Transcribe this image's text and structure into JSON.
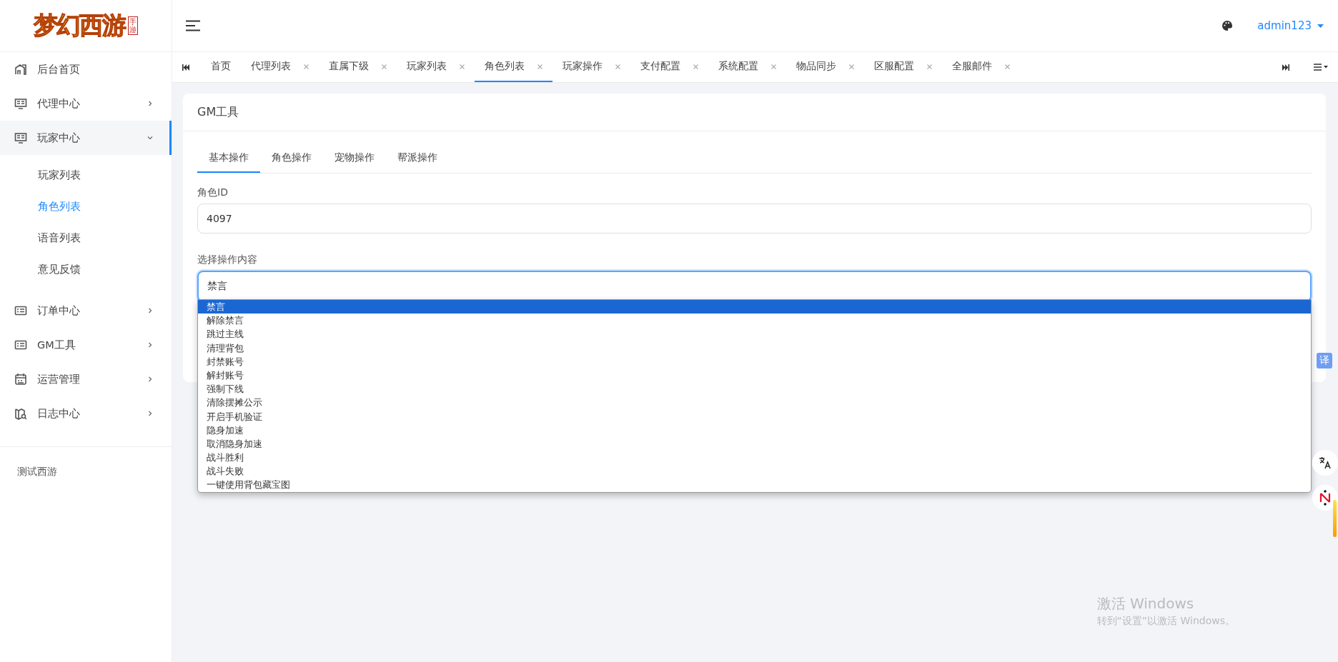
{
  "logo": {
    "title": "梦幻西游",
    "badge": "手游"
  },
  "sidebar": {
    "items": [
      {
        "label": "后台首页",
        "kind": "home",
        "selected": false
      },
      {
        "label": "代理中心",
        "kind": "monitor",
        "selected": false,
        "expanded": false
      },
      {
        "label": "玩家中心",
        "kind": "monitor",
        "selected": true,
        "expanded": true,
        "children": [
          {
            "label": "玩家列表",
            "selected": false
          },
          {
            "label": "角色列表",
            "selected": true
          },
          {
            "label": "语音列表",
            "selected": false
          },
          {
            "label": "意见反馈",
            "selected": false
          }
        ]
      },
      {
        "label": "订单中心",
        "kind": "list",
        "selected": false,
        "expanded": false
      },
      {
        "label": "GM工具",
        "kind": "list",
        "selected": false,
        "expanded": false
      },
      {
        "label": "运营管理",
        "kind": "calendar",
        "selected": false,
        "expanded": false
      },
      {
        "label": "日志中心",
        "kind": "map",
        "selected": false,
        "expanded": false
      }
    ],
    "footer": "测试西游"
  },
  "topbar": {
    "user": "admin123"
  },
  "tabs": [
    {
      "label": "首页",
      "closable": false,
      "selected": false
    },
    {
      "label": "代理列表",
      "closable": true,
      "selected": false
    },
    {
      "label": "直属下级",
      "closable": true,
      "selected": false
    },
    {
      "label": "玩家列表",
      "closable": true,
      "selected": false
    },
    {
      "label": "角色列表",
      "closable": true,
      "selected": true
    },
    {
      "label": "玩家操作",
      "closable": true,
      "selected": false
    },
    {
      "label": "支付配置",
      "closable": true,
      "selected": false
    },
    {
      "label": "系统配置",
      "closable": true,
      "selected": false
    },
    {
      "label": "物品同步",
      "closable": true,
      "selected": false
    },
    {
      "label": "区服配置",
      "closable": true,
      "selected": false
    },
    {
      "label": "全服邮件",
      "closable": true,
      "selected": false
    }
  ],
  "card": {
    "title": "GM工具",
    "tabs": [
      {
        "label": "基本操作",
        "selected": true
      },
      {
        "label": "角色操作",
        "selected": false
      },
      {
        "label": "宠物操作",
        "selected": false
      },
      {
        "label": "帮派操作",
        "selected": false
      }
    ],
    "role_id": {
      "label": "角色ID",
      "value": "4097"
    },
    "operation": {
      "label": "选择操作内容",
      "value": "禁言",
      "options": [
        {
          "label": "禁言",
          "selected": true
        },
        {
          "label": "解除禁言",
          "selected": false
        },
        {
          "label": "跳过主线",
          "selected": false
        },
        {
          "label": "清理背包",
          "selected": false
        },
        {
          "label": "封禁账号",
          "selected": false
        },
        {
          "label": "解封账号",
          "selected": false
        },
        {
          "label": "强制下线",
          "selected": false
        },
        {
          "label": "清除摆摊公示",
          "selected": false
        },
        {
          "label": "开启手机验证",
          "selected": false
        },
        {
          "label": "隐身加速",
          "selected": false
        },
        {
          "label": "取消隐身加速",
          "selected": false
        },
        {
          "label": "战斗胜利",
          "selected": false
        },
        {
          "label": "战斗失败",
          "selected": false
        },
        {
          "label": "一键使用背包藏宝图",
          "selected": false
        }
      ]
    }
  },
  "floating": {
    "translate_label": "译"
  },
  "os_notice": {
    "title": "激活 Windows",
    "text": "转到“设置”以激活 Windows。"
  }
}
